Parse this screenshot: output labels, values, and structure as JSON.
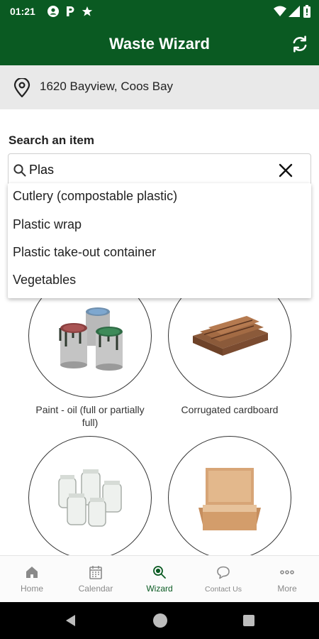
{
  "status_bar": {
    "time": "01:21"
  },
  "app_bar": {
    "title": "Waste Wizard"
  },
  "location": {
    "address": "1620 Bayview, Coos Bay"
  },
  "search": {
    "label": "Search an item",
    "value": "Plas",
    "suggestions": [
      "Cutlery (compostable plastic)",
      "Plastic wrap",
      "Plastic take-out container",
      "Vegetables"
    ]
  },
  "items": [
    {
      "caption": "Paint - oil (full or partially full)"
    },
    {
      "caption": "Corrugated cardboard"
    },
    {
      "caption": ""
    },
    {
      "caption": ""
    }
  ],
  "bottom_nav": [
    {
      "label": "Home",
      "icon": "home-icon",
      "active": false
    },
    {
      "label": "Calendar",
      "icon": "calendar-icon",
      "active": false
    },
    {
      "label": "Wizard",
      "icon": "wizard-search-icon",
      "active": true
    },
    {
      "label": "Contact Us",
      "icon": "chat-bubble-icon",
      "active": false
    },
    {
      "label": "More",
      "icon": "more-dots-icon",
      "active": false
    }
  ],
  "colors": {
    "brand_green": "#0a5a22",
    "address_bg": "#e9e9e9"
  }
}
